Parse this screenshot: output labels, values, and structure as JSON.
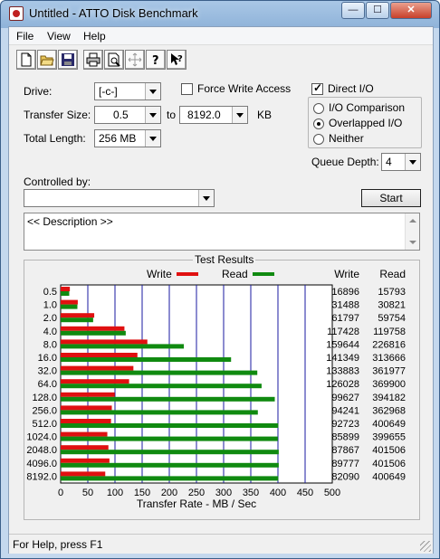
{
  "window": {
    "title": "Untitled - ATTO Disk Benchmark",
    "controls": {
      "minimize": "—",
      "maximize": "☐",
      "close": "✕"
    }
  },
  "menu": [
    "File",
    "View",
    "Help"
  ],
  "toolbar_icons": [
    "new-file-icon",
    "open-folder-icon",
    "save-icon",
    "print-icon",
    "print-preview-icon",
    "move-icon",
    "help-icon",
    "context-help-icon"
  ],
  "settings": {
    "drive_label": "Drive:",
    "drive_value": "[-c-]",
    "force_write_label": "Force Write Access",
    "force_write_checked": false,
    "direct_io_label": "Direct I/O",
    "direct_io_checked": true,
    "transfer_size_label": "Transfer Size:",
    "transfer_from": "0.5",
    "to_label": "to",
    "transfer_to": "8192.0",
    "kb_label": "KB",
    "total_length_label": "Total Length:",
    "total_length_value": "256 MB",
    "io_comparison_label": "I/O Comparison",
    "overlapped_io_label": "Overlapped I/O",
    "neither_label": "Neither",
    "selected_mode": "Overlapped I/O",
    "queue_depth_label": "Queue Depth:",
    "queue_depth_value": "4",
    "controlled_by_label": "Controlled by:",
    "controlled_by_value": "",
    "start_label": "Start",
    "description": "<< Description >>"
  },
  "chart_data": {
    "type": "bar",
    "title": "Test Results",
    "legend": [
      {
        "name": "Write",
        "color": "#e01010"
      },
      {
        "name": "Read",
        "color": "#108a10"
      }
    ],
    "column_headers": [
      "Write",
      "Read"
    ],
    "xlabel": "Transfer Rate - MB / Sec",
    "xlim": [
      0,
      500
    ],
    "xticks": [
      0,
      50,
      100,
      150,
      200,
      250,
      300,
      350,
      400,
      450,
      500
    ],
    "categories": [
      "0.5",
      "1.0",
      "2.0",
      "4.0",
      "8.0",
      "16.0",
      "32.0",
      "64.0",
      "128.0",
      "256.0",
      "512.0",
      "1024.0",
      "2048.0",
      "4096.0",
      "8192.0"
    ],
    "series": [
      {
        "name": "Write",
        "color": "#e01010",
        "values_mbps": [
          16.9,
          31.5,
          61.8,
          117.4,
          159.6,
          141.3,
          133.9,
          126.0,
          99.6,
          94.2,
          92.7,
          85.9,
          87.9,
          89.8,
          82.1
        ],
        "values_text": [
          "16896",
          "31488",
          "61797",
          "117428",
          "159644",
          "141349",
          "133883",
          "126028",
          "99627",
          "94241",
          "92723",
          "85899",
          "87867",
          "89777",
          "82090"
        ]
      },
      {
        "name": "Read",
        "color": "#108a10",
        "values_mbps": [
          15.8,
          30.8,
          59.8,
          119.8,
          226.8,
          313.7,
          362.0,
          369.9,
          394.2,
          363.0,
          400.6,
          399.7,
          401.5,
          401.5,
          400.6
        ],
        "values_text": [
          "15793",
          "30821",
          "59754",
          "119758",
          "226816",
          "313666",
          "361977",
          "369900",
          "394182",
          "362968",
          "400649",
          "399655",
          "401506",
          "401506",
          "400649"
        ]
      }
    ],
    "grid": true
  },
  "status": "For Help, press F1"
}
